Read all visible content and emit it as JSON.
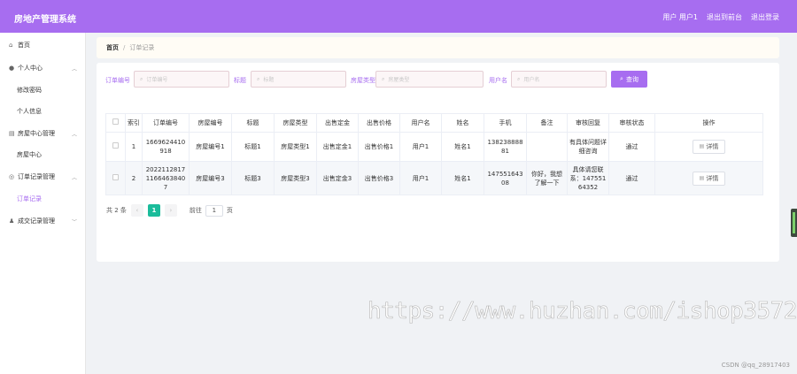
{
  "header": {
    "title": "房地产管理系统",
    "user": "用户 用户1",
    "back_to_front": "退出到前台",
    "logout": "退出登录"
  },
  "sidebar": {
    "items": [
      {
        "label": "首页",
        "icon": "home-icon",
        "type": "top"
      },
      {
        "label": "个人中心",
        "icon": "user-icon",
        "type": "group"
      },
      {
        "label": "修改密码",
        "type": "sub"
      },
      {
        "label": "个人信息",
        "type": "sub"
      },
      {
        "label": "房屋中心管理",
        "icon": "house-icon",
        "type": "group"
      },
      {
        "label": "房屋中心",
        "type": "sub"
      },
      {
        "label": "订单记录管理",
        "icon": "globe-icon",
        "type": "group"
      },
      {
        "label": "订单记录",
        "type": "sub",
        "active": true
      },
      {
        "label": "成交记录管理",
        "icon": "person-icon",
        "type": "group"
      }
    ]
  },
  "breadcrumb": {
    "home": "首页",
    "separator": "/",
    "current": "订单记录"
  },
  "search": {
    "fields": [
      {
        "label": "订单编号",
        "placeholder": "订单编号"
      },
      {
        "label": "标题",
        "placeholder": "标题"
      },
      {
        "label": "房屋类型",
        "placeholder": "房屋类型"
      },
      {
        "label": "用户名",
        "placeholder": "用户名"
      }
    ],
    "query_label": "查询"
  },
  "table": {
    "headers": [
      "索引",
      "订单编号",
      "房屋编号",
      "标题",
      "房屋类型",
      "出售定金",
      "出售价格",
      "用户名",
      "姓名",
      "手机",
      "备注",
      "审核回复",
      "审核状态",
      "操作"
    ],
    "rows": [
      [
        "1",
        "1669624410918",
        "房屋编号1",
        "标题1",
        "房屋类型1",
        "出售定金1",
        "出售价格1",
        "用户1",
        "姓名1",
        "13823888881",
        "",
        "有具体问题详细咨询",
        "通过",
        "详情"
      ],
      [
        "2",
        "20221128171166463840 7",
        "房屋编号3",
        "标题3",
        "房屋类型3",
        "出售定金3",
        "出售价格3",
        "用户1",
        "姓名1",
        "14755164308",
        "你好，我想了解一下",
        "具体请您联系：14755164352",
        "通过",
        "详情"
      ]
    ]
  },
  "pagination": {
    "total": "共 2 条",
    "current_page": "1",
    "goto_label": "前往",
    "goto_value": "1",
    "page_suffix": "页"
  },
  "watermark": "https://www.huzhan.com/ishop3572",
  "csdn_credit": "CSDN @qq_28917403",
  "colors": {
    "accent": "#a76df0",
    "pager_active": "#1bbc9b"
  }
}
